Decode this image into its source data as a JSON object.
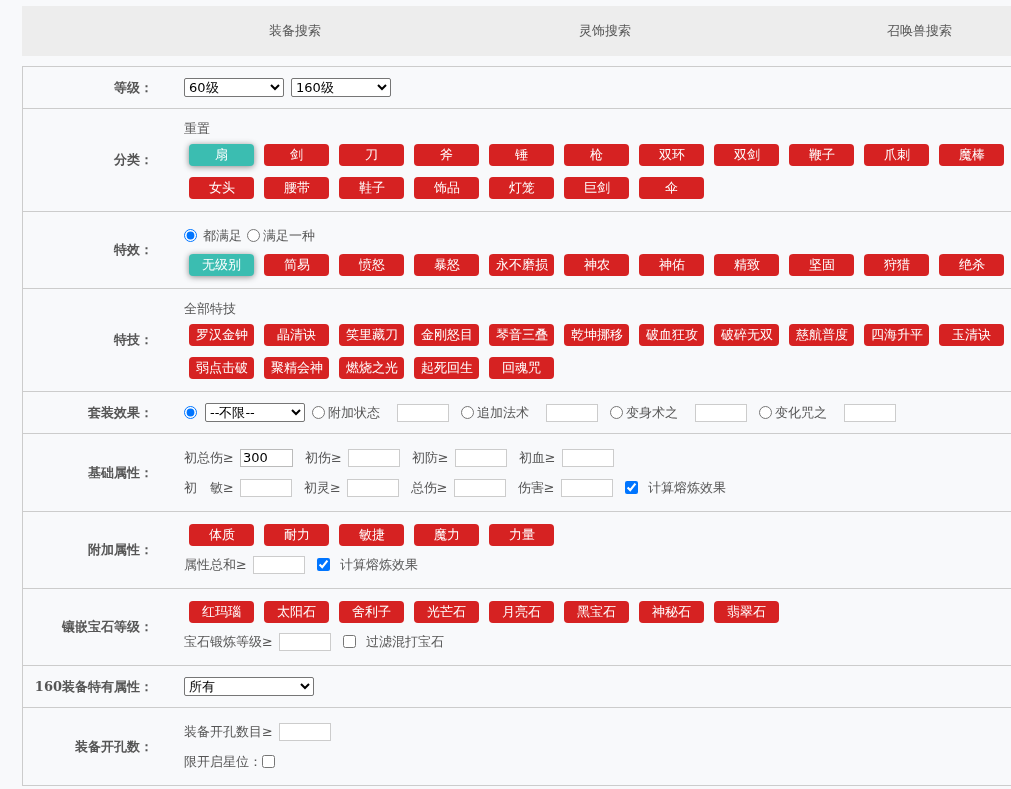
{
  "tabs": [
    {
      "label": "装备搜索"
    },
    {
      "label": "灵饰搜索"
    },
    {
      "label": "召唤兽搜索"
    }
  ],
  "rows": [
    {
      "label": "等级：",
      "blocks": [
        {
          "kind": "line",
          "items": [
            {
              "kind": "select",
              "value": "60级"
            },
            {
              "kind": "select",
              "value": "160级"
            }
          ]
        }
      ]
    },
    {
      "label": "分类：",
      "blocks": [
        {
          "kind": "link",
          "text": "重置"
        },
        {
          "kind": "chips",
          "chips": [
            {
              "label": "扇",
              "selected": true
            },
            {
              "label": "剑",
              "selected": false
            },
            {
              "label": "刀",
              "selected": false
            },
            {
              "label": "斧",
              "selected": false
            },
            {
              "label": "锤",
              "selected": false
            },
            {
              "label": "枪",
              "selected": false
            },
            {
              "label": "双环",
              "selected": false
            },
            {
              "label": "双剑",
              "selected": false
            },
            {
              "label": "鞭子",
              "selected": false
            },
            {
              "label": "爪刺",
              "selected": false
            },
            {
              "label": "魔棒",
              "selected": false
            },
            {
              "label": "女头",
              "selected": false
            },
            {
              "label": "腰带",
              "selected": false
            },
            {
              "label": "鞋子",
              "selected": false
            },
            {
              "label": "饰品",
              "selected": false
            },
            {
              "label": "灯笼",
              "selected": false
            },
            {
              "label": "巨剑",
              "selected": false
            },
            {
              "label": "伞",
              "selected": false
            }
          ]
        }
      ]
    },
    {
      "label": "特效：",
      "blocks": [
        {
          "kind": "line",
          "items": [
            {
              "kind": "radio",
              "label": "都满足",
              "selected": true
            },
            {
              "kind": "radio",
              "label": "满足一种",
              "selected": false
            }
          ]
        },
        {
          "kind": "chips",
          "chips": [
            {
              "label": "无级别",
              "selected": true
            },
            {
              "label": "简易",
              "selected": false
            },
            {
              "label": "愤怒",
              "selected": false
            },
            {
              "label": "暴怒",
              "selected": false
            },
            {
              "label": "永不磨损",
              "selected": false
            },
            {
              "label": "神农",
              "selected": false
            },
            {
              "label": "神佑",
              "selected": false
            },
            {
              "label": "精致",
              "selected": false
            },
            {
              "label": "坚固",
              "selected": false
            },
            {
              "label": "狩猎",
              "selected": false
            },
            {
              "label": "绝杀",
              "selected": false
            }
          ]
        }
      ]
    },
    {
      "label": "特技：",
      "blocks": [
        {
          "kind": "link",
          "text": "全部特技"
        },
        {
          "kind": "chips",
          "chips": [
            {
              "label": "罗汉金钟",
              "selected": false
            },
            {
              "label": "晶清诀",
              "selected": false
            },
            {
              "label": "笑里藏刀",
              "selected": false
            },
            {
              "label": "金刚怒目",
              "selected": false
            },
            {
              "label": "琴音三叠",
              "selected": false
            },
            {
              "label": "乾坤挪移",
              "selected": false
            },
            {
              "label": "破血狂攻",
              "selected": false
            },
            {
              "label": "破碎无双",
              "selected": false
            },
            {
              "label": "慈航普度",
              "selected": false
            },
            {
              "label": "四海升平",
              "selected": false
            },
            {
              "label": "玉清诀",
              "selected": false
            },
            {
              "label": "弱点击破",
              "selected": false
            },
            {
              "label": "聚精会神",
              "selected": false
            },
            {
              "label": "燃烧之光",
              "selected": false
            },
            {
              "label": "起死回生",
              "selected": false
            },
            {
              "label": "回魂咒",
              "selected": false
            }
          ]
        }
      ]
    },
    {
      "label": "套装效果：",
      "blocks": [
        {
          "kind": "line",
          "items": [
            {
              "kind": "radio",
              "selected": true
            },
            {
              "kind": "select",
              "value": "--不限--"
            },
            {
              "kind": "radio",
              "label": "附加状态",
              "selected": false
            },
            {
              "kind": "input"
            },
            {
              "kind": "radio",
              "label": "追加法术",
              "selected": false
            },
            {
              "kind": "input"
            },
            {
              "kind": "radio",
              "label": "变身术之",
              "selected": false
            },
            {
              "kind": "input"
            },
            {
              "kind": "radio",
              "label": "变化咒之",
              "selected": false
            },
            {
              "kind": "input"
            }
          ]
        }
      ]
    },
    {
      "label": "基础属性：",
      "blocks": [
        {
          "kind": "line",
          "items": [
            {
              "kind": "number",
              "label": "初总伤≥",
              "value": "300"
            },
            {
              "kind": "input",
              "label": "初伤≥"
            },
            {
              "kind": "input",
              "label": "初防≥"
            },
            {
              "kind": "input",
              "label": "初血≥"
            }
          ]
        },
        {
          "kind": "line",
          "items": [
            {
              "kind": "input",
              "label": "初　敏≥"
            },
            {
              "kind": "input",
              "label": "初灵≥"
            },
            {
              "kind": "input",
              "label": "总伤≥"
            },
            {
              "kind": "input",
              "label": "伤害≥"
            },
            {
              "kind": "checkbox",
              "label": "计算熔炼效果",
              "checked": true
            }
          ]
        }
      ]
    },
    {
      "label": "附加属性：",
      "blocks": [
        {
          "kind": "chips",
          "chips": [
            {
              "label": "体质",
              "selected": false
            },
            {
              "label": "耐力",
              "selected": false
            },
            {
              "label": "敏捷",
              "selected": false
            },
            {
              "label": "魔力",
              "selected": false
            },
            {
              "label": "力量",
              "selected": false
            }
          ]
        },
        {
          "kind": "line",
          "items": [
            {
              "kind": "input",
              "label": "属性总和≥"
            },
            {
              "kind": "checkbox",
              "label": "计算熔炼效果",
              "checked": true
            }
          ]
        }
      ]
    },
    {
      "label": "镶嵌宝石等级：",
      "blocks": [
        {
          "kind": "chips",
          "chips": [
            {
              "label": "红玛瑙",
              "selected": false
            },
            {
              "label": "太阳石",
              "selected": false
            },
            {
              "label": "舍利子",
              "selected": false
            },
            {
              "label": "光芒石",
              "selected": false
            },
            {
              "label": "月亮石",
              "selected": false
            },
            {
              "label": "黑宝石",
              "selected": false
            },
            {
              "label": "神秘石",
              "selected": false
            },
            {
              "label": "翡翠石",
              "selected": false
            }
          ]
        },
        {
          "kind": "line",
          "items": [
            {
              "kind": "input",
              "label": "宝石锻炼等级≥"
            },
            {
              "kind": "checkbox",
              "label": "过滤混打宝石",
              "checked": false
            }
          ]
        }
      ]
    },
    {
      "label": "160装备特有属性：",
      "blocks": [
        {
          "kind": "line",
          "items": [
            {
              "kind": "select",
              "value": "所有"
            }
          ]
        }
      ]
    },
    {
      "label": "装备开孔数：",
      "blocks": [
        {
          "kind": "line",
          "items": [
            {
              "kind": "input",
              "label": "装备开孔数目≥"
            }
          ]
        },
        {
          "kind": "line",
          "items": [
            {
              "kind": "text",
              "text": "限开启星位："
            },
            {
              "kind": "checkbox",
              "checked": false
            }
          ]
        }
      ]
    }
  ]
}
